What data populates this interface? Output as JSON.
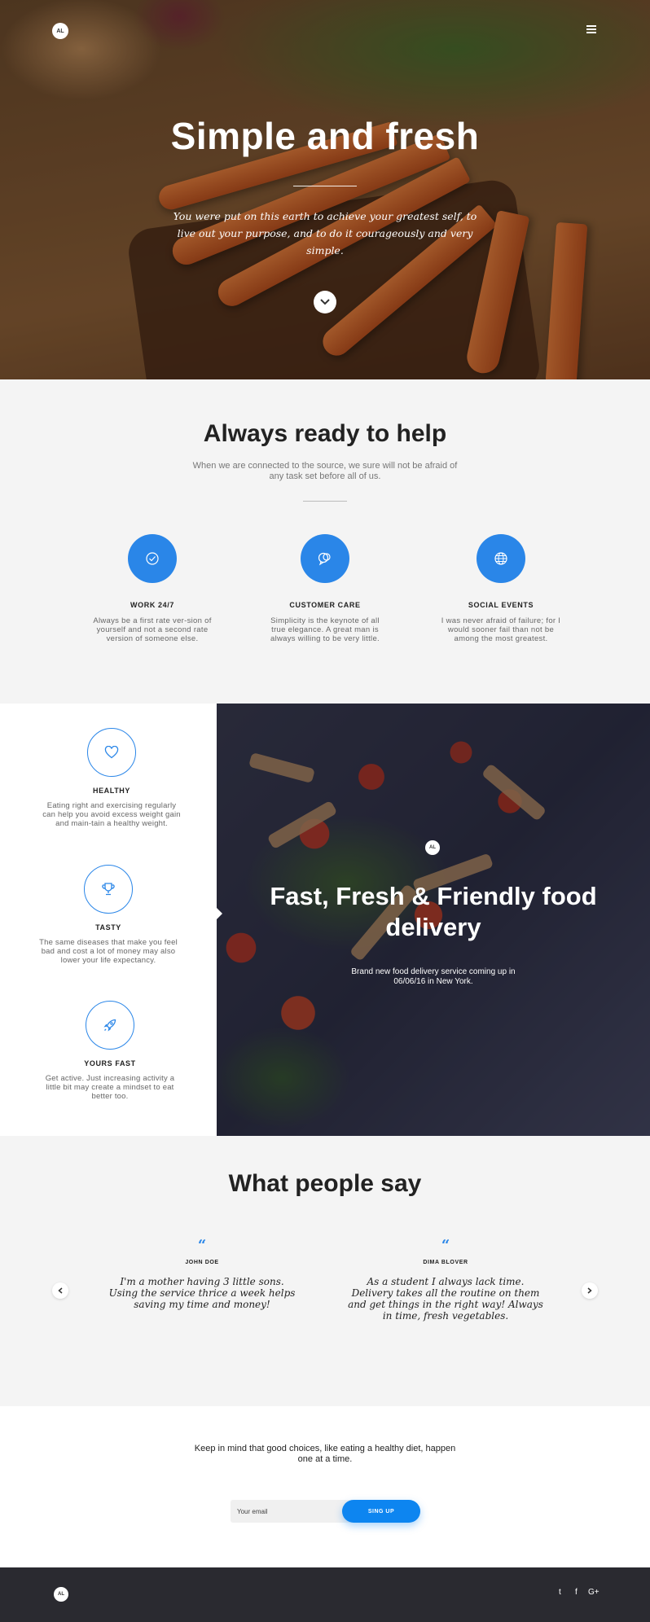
{
  "brand": {
    "logo": "AL"
  },
  "hero": {
    "title": "Simple and fresh",
    "subtitle": "You were put on this earth to achieve your greatest self, to live out your purpose, and to do it courageously and very simple.",
    "menu_icon": "hamburger-icon",
    "scroll_icon": "chevron-down-icon"
  },
  "help": {
    "title": "Always ready to help",
    "subtitle": "When we are connected to the source, we sure will not be afraid of any task set before all of us.",
    "features": [
      {
        "icon": "check-circle-icon",
        "title": "WORK 24/7",
        "text": "Always be a first rate ver-sion of yourself and not a second rate version of someone else."
      },
      {
        "icon": "chat-bubbles-icon",
        "title": "CUSTOMER CARE",
        "text": "Simplicity is the keynote of all true elegance. A great man is always willing to be very little."
      },
      {
        "icon": "globe-icon",
        "title": "SOCIAL EVENTS",
        "text": "I was never afraid of failure; for I would sooner fail than not be among the most greatest."
      }
    ]
  },
  "benefits": [
    {
      "icon": "heart-icon",
      "title": "HEALTHY",
      "text": "Eating right and exercising regularly can help you avoid excess weight gain and main-tain a healthy weight."
    },
    {
      "icon": "trophy-icon",
      "title": "TASTY",
      "text": "The same diseases that make you feel bad and cost a lot of money may also lower your life expectancy."
    },
    {
      "icon": "rocket-icon",
      "title": "YOURS FAST",
      "text": "Get active. Just increasing activity a little bit may create a mindset to eat better too."
    }
  ],
  "delivery": {
    "title": "Fast, Fresh & Friendly food delivery",
    "subtitle": "Brand new food delivery service coming up in 06/06/16 in New York."
  },
  "testimonials": {
    "title": "What people say",
    "quote_mark": "“",
    "prev_icon": "chevron-left-icon",
    "next_icon": "chevron-right-icon",
    "items": [
      {
        "name": "JOHN DOE",
        "text": "I'm a mother having 3 little sons. Using the service thrice a week helps saving my time and money!"
      },
      {
        "name": "DIMA BLOVER",
        "text": "As a student I always lack time. Delivery takes all the routine on them and get things in the right way! Always in time, fresh vegetables."
      }
    ]
  },
  "newsletter": {
    "text": "Keep in mind that good choices, like eating a healthy diet, happen one at a time.",
    "placeholder": "Your email",
    "button": "SING UP"
  },
  "footer": {
    "social": [
      {
        "icon": "twitter-icon",
        "glyph": "t"
      },
      {
        "icon": "facebook-icon",
        "glyph": "f"
      },
      {
        "icon": "google-plus-icon",
        "glyph": "G+"
      }
    ]
  },
  "colors": {
    "accent": "#2a86e8",
    "button": "#0d85f0",
    "footer": "#2a2a30",
    "background": "#f4f4f4"
  }
}
